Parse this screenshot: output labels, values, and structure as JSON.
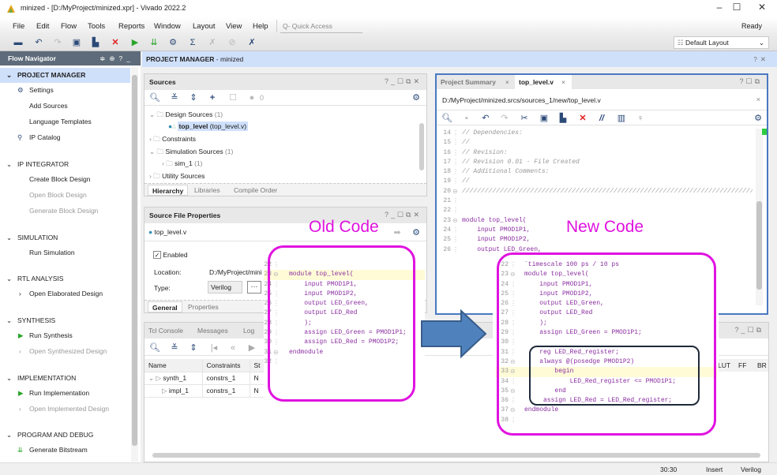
{
  "window": {
    "title": "minized - [D:/MyProject/minized.xpr] - Vivado 2022.2",
    "status": "Ready",
    "controls": {
      "minimize": "–",
      "maximize": "☐",
      "close": "✕"
    }
  },
  "menu": {
    "items": [
      "File",
      "Edit",
      "Flow",
      "Tools",
      "Reports",
      "Window",
      "Layout",
      "View",
      "Help"
    ],
    "quick_access_placeholder": "Q- Quick Access"
  },
  "toolbar": {
    "icons": [
      "open-project-icon",
      "undo-icon",
      "redo-icon",
      "copy-icon",
      "paste-icon",
      "delete-icon",
      "run-icon",
      "generate-bitstream-icon",
      "settings-icon",
      "sigma-icon",
      "disabled-tool-icon",
      "disabled-tool-icon-2",
      "cancel-tool-icon"
    ],
    "layout_select": "Default Layout"
  },
  "flow_navigator": {
    "title": "Flow Navigator",
    "sections": [
      {
        "label": "PROJECT MANAGER",
        "items": [
          {
            "label": "Settings",
            "icon": "gear",
            "enabled": true
          },
          {
            "label": "Add Sources",
            "icon": "",
            "enabled": true
          },
          {
            "label": "Language Templates",
            "icon": "",
            "enabled": true
          },
          {
            "label": "IP Catalog",
            "icon": "ip",
            "enabled": true
          }
        ]
      },
      {
        "label": "IP INTEGRATOR",
        "items": [
          {
            "label": "Create Block Design",
            "enabled": true
          },
          {
            "label": "Open Block Design",
            "enabled": false
          },
          {
            "label": "Generate Block Design",
            "enabled": false
          }
        ]
      },
      {
        "label": "SIMULATION",
        "items": [
          {
            "label": "Run Simulation",
            "enabled": true
          }
        ]
      },
      {
        "label": "RTL ANALYSIS",
        "items": [
          {
            "label": "Open Elaborated Design",
            "enabled": true
          }
        ]
      },
      {
        "label": "SYNTHESIS",
        "items": [
          {
            "label": "Run Synthesis",
            "enabled": true
          },
          {
            "label": "Open Synthesized Design",
            "enabled": false
          }
        ]
      },
      {
        "label": "IMPLEMENTATION",
        "items": [
          {
            "label": "Run Implementation",
            "enabled": true
          },
          {
            "label": "Open Implemented Design",
            "enabled": false
          }
        ]
      },
      {
        "label": "PROGRAM AND DEBUG",
        "items": [
          {
            "label": "Generate Bitstream",
            "enabled": true
          }
        ]
      }
    ]
  },
  "project_manager": {
    "title": "PROJECT MANAGER",
    "suffix": " - minized"
  },
  "sources": {
    "title": "Sources",
    "badge_count": "0",
    "tree": {
      "design_sources": "Design Sources",
      "design_sources_count": "(1)",
      "top_name": "top_level",
      "top_file": "(top_level.v)",
      "constraints": "Constraints",
      "simulation_sources": "Simulation Sources",
      "simulation_sources_count": "(1)",
      "sim": "sim_1",
      "sim_count": "(1)",
      "utility": "Utility Sources"
    },
    "tabs": [
      "Hierarchy",
      "Libraries",
      "Compile Order"
    ]
  },
  "file_props": {
    "title": "Source File Properties",
    "file": "top_level.v",
    "enabled_label": "Enabled",
    "location_label": "Location:",
    "location_value": "D:/MyProject/mini",
    "type_label": "Type:",
    "type_value": "Verilog",
    "tabs": [
      "General",
      "Properties"
    ]
  },
  "console": {
    "tabs": [
      "Tcl Console",
      "Messages",
      "Log"
    ],
    "columns": [
      "Name",
      "Constraints",
      "St"
    ],
    "rows": [
      {
        "name": "synth_1",
        "constraints": "constrs_1",
        "status": "N"
      },
      {
        "name": "impl_1",
        "constraints": "constrs_1",
        "status": "N"
      }
    ],
    "right_columns": [
      "LUT",
      "FF",
      "BR"
    ]
  },
  "editor": {
    "tabs": [
      "Project Summary",
      "top_level.v"
    ],
    "path": "D:/MyProject/minized.srcs/sources_1/new/top_level.v",
    "lines": [
      {
        "n": "14",
        "t": "// Dependencies:",
        "c": "cm"
      },
      {
        "n": "15",
        "t": "//",
        "c": "cm"
      },
      {
        "n": "16",
        "t": "// Revision:",
        "c": "cm"
      },
      {
        "n": "17",
        "t": "// Revision 0.01 - File Created",
        "c": "cm"
      },
      {
        "n": "18",
        "t": "// Additional Comments:",
        "c": "cm"
      },
      {
        "n": "19",
        "t": "//",
        "c": "cm"
      },
      {
        "n": "20",
        "t": "//////////////////////////////////////////////////////////////////////////////////",
        "c": "cm"
      },
      {
        "n": "21",
        "t": "",
        "c": ""
      },
      {
        "n": "22",
        "t": "",
        "c": ""
      },
      {
        "n": "23",
        "t": "module top_level(",
        "c": "kw"
      },
      {
        "n": "24",
        "t": "    input PMOD1P1,",
        "c": "kw"
      },
      {
        "n": "25",
        "t": "    input PMOD1P2,",
        "c": "kw"
      },
      {
        "n": "26",
        "t": "    output LED_Green,",
        "c": "kw"
      }
    ]
  },
  "annotations": {
    "old_label": "Old Code",
    "new_label": "New Code",
    "old_code": [
      {
        "n": "22",
        "t": ""
      },
      {
        "n": "23",
        "t": "module top_level("
      },
      {
        "n": "24",
        "t": "    input PMOD1P1,"
      },
      {
        "n": "25",
        "t": "    input PMOD1P2,"
      },
      {
        "n": "26",
        "t": "    output LED_Green,"
      },
      {
        "n": "27",
        "t": "    output LED_Red"
      },
      {
        "n": "28",
        "t": "    );"
      },
      {
        "n": "29",
        "t": "    assign LED_Green = PMOD1P1;"
      },
      {
        "n": "30",
        "t": "    assign LED_Red = PMOD1P2;"
      },
      {
        "n": "31",
        "t": "endmodule"
      },
      {
        "n": "32",
        "t": ""
      }
    ],
    "new_code": [
      {
        "n": "22",
        "t": "`timescale 100 ps / 10 ps"
      },
      {
        "n": "23",
        "t": "module top_level("
      },
      {
        "n": "24",
        "t": "    input PMOD1P1,"
      },
      {
        "n": "25",
        "t": "    input PMOD1P2,"
      },
      {
        "n": "26",
        "t": "    output LED_Green,"
      },
      {
        "n": "27",
        "t": "    output LED_Red"
      },
      {
        "n": "28",
        "t": "    );"
      },
      {
        "n": "29",
        "t": "    assign LED_Green = PMOD1P1;"
      },
      {
        "n": "30",
        "t": ""
      },
      {
        "n": "31",
        "t": "    reg LED_Red_register;"
      },
      {
        "n": "32",
        "t": "    always @(posedge PMOD1P2)"
      },
      {
        "n": "33",
        "t": "        begin"
      },
      {
        "n": "34",
        "t": "            LED_Red_register <= PMOD1P1;"
      },
      {
        "n": "35",
        "t": "        end"
      },
      {
        "n": "36",
        "t": "     assign LED_Red = LED_Red_register;"
      },
      {
        "n": "37",
        "t": "endmodule"
      },
      {
        "n": "38",
        "t": ""
      }
    ],
    "accent": "#e012e0",
    "arrow_color": "#4f81bd"
  },
  "status_bar": {
    "position": "30:30",
    "mode": "Insert",
    "language": "Verilog"
  }
}
